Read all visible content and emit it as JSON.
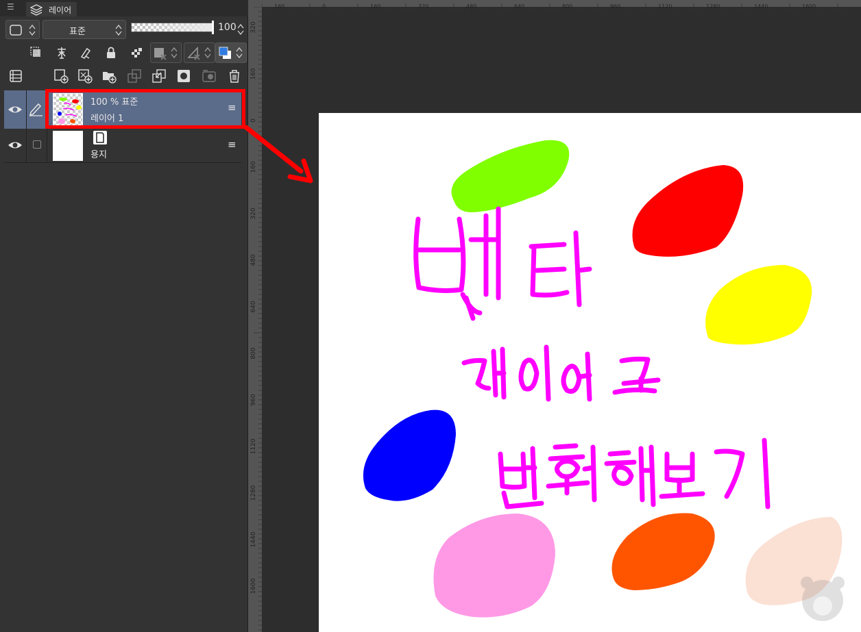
{
  "panel": {
    "menu_glyph": "☰",
    "tab_label": "레이어",
    "tab_icon": "layers-icon"
  },
  "toolbar": {
    "blend_mode": "표준",
    "opacity_value": "100",
    "opacity_fraction": 1.0
  },
  "layers": [
    {
      "id": "layer1",
      "opacity_mode": "100 % 표준",
      "name": "레이어 1",
      "visible": true,
      "selected": true
    },
    {
      "id": "paper",
      "name": "용지",
      "visible": true,
      "selected": false
    }
  ],
  "row_menu_glyph": "≡",
  "ruler": {
    "horizontal_ticks": [
      "160",
      "0",
      "160",
      "320",
      "480",
      "640",
      "800",
      "960",
      "1120",
      "1280",
      "1440",
      "1600"
    ],
    "vertical_ticks": [
      "320",
      "160",
      "0",
      "160",
      "320",
      "480",
      "640",
      "800",
      "960",
      "1120",
      "1280",
      "1440",
      "1600"
    ]
  },
  "canvas": {
    "text_lines": [
      "벡터",
      "레이어로",
      "변환해보기"
    ],
    "text_color": "#ff00ff",
    "blob_colors": [
      "#80ff00",
      "#ff0000",
      "#ffff00",
      "#0000ff",
      "#ff99e6",
      "#ff5500",
      "#fbe0d4"
    ]
  },
  "colors": {
    "highlight_box": "#ff0000",
    "selected_row": "#5b6b8a"
  }
}
